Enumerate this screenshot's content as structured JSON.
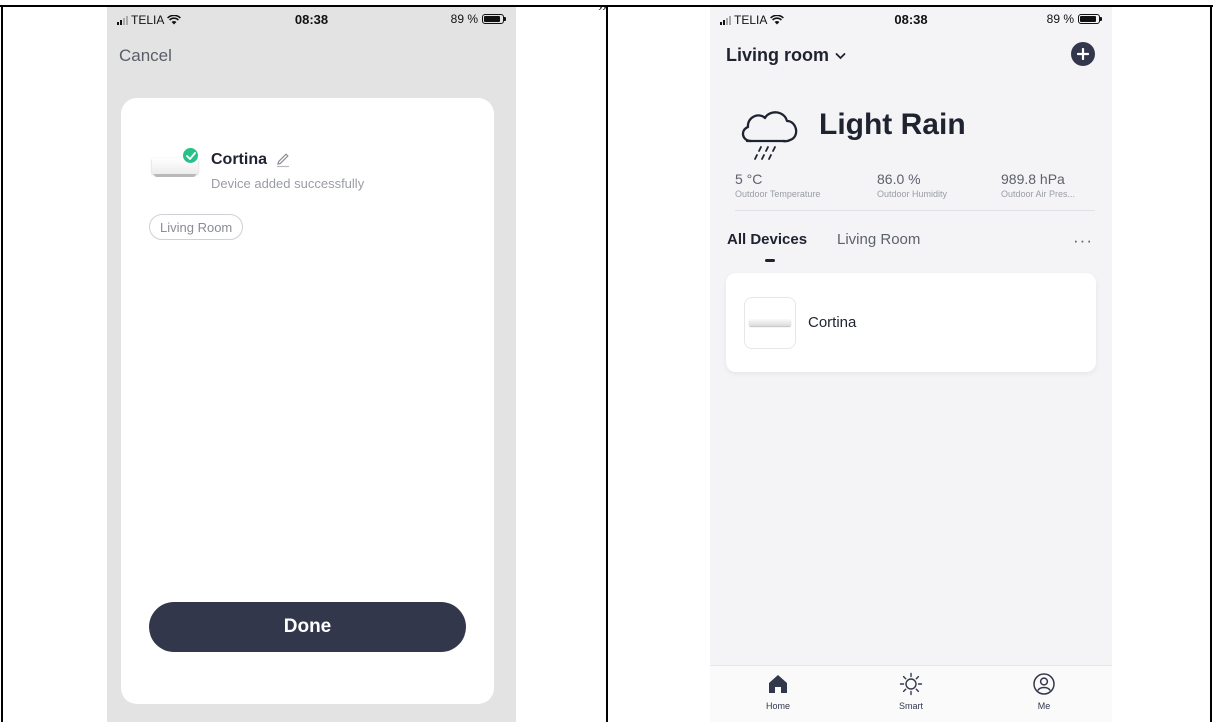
{
  "left_screen": {
    "status_bar": {
      "carrier": "TELIA",
      "time": "08:38",
      "battery": "89 %",
      "battery_level": 0.89
    },
    "cancel_label": "Cancel",
    "device": {
      "name": "Cortina",
      "status": "Device added successfully"
    },
    "room_chip": "Living Room",
    "done_label": "Done"
  },
  "right_screen": {
    "status_bar": {
      "carrier": "TELIA",
      "time": "08:38",
      "battery": "89 %",
      "battery_level": 0.89
    },
    "home_title": "Living room",
    "weather": {
      "condition": "Light Rain",
      "stats": [
        {
          "value": "5 °C",
          "label": "Outdoor Temperature"
        },
        {
          "value": "86.0 %",
          "label": "Outdoor Humidity"
        },
        {
          "value": "989.8 hPa",
          "label": "Outdoor Air Pres..."
        }
      ]
    },
    "tabs": [
      "All Devices",
      "Living Room"
    ],
    "more_label": "···",
    "devices": [
      {
        "name": "Cortina"
      }
    ],
    "tabbar": [
      {
        "label": "Home"
      },
      {
        "label": "Smart"
      },
      {
        "label": "Me"
      }
    ]
  },
  "colors": {
    "primary_dark": "#33374c",
    "success_green": "#27c28a",
    "muted_text": "#9a9da6"
  },
  "icons": [
    "signal-icon",
    "wifi-icon",
    "battery-icon",
    "check-circle-icon",
    "pencil-icon",
    "chevron-down-icon",
    "plus-icon",
    "cloud-rain-icon",
    "more-icon",
    "home-icon",
    "sun-icon",
    "user-icon"
  ]
}
